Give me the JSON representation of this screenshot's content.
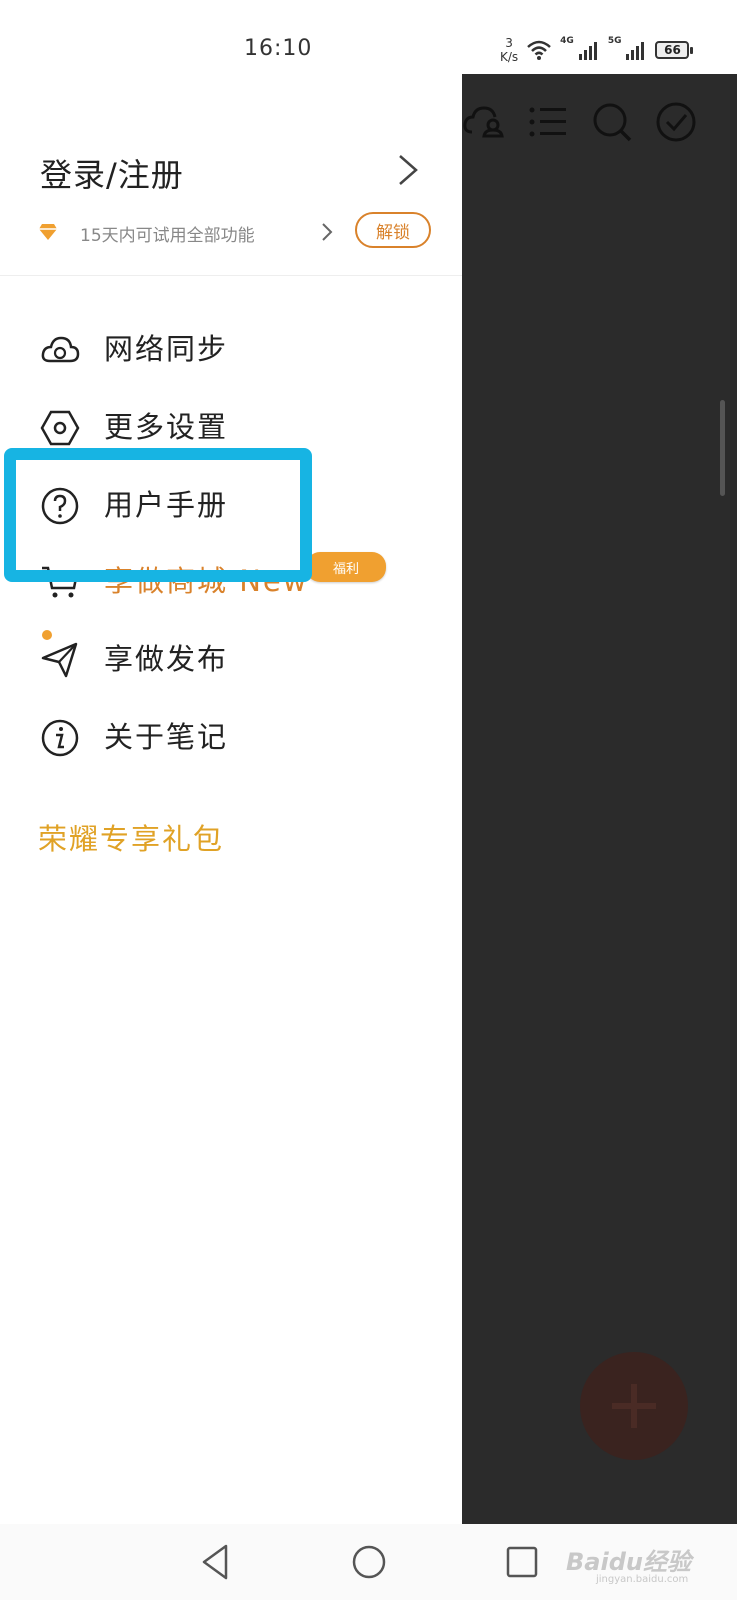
{
  "status_bar": {
    "time": "16:10",
    "net_speed_value": "3",
    "net_speed_unit": "K/s",
    "signal1_label": "4G",
    "signal2_label": "5G",
    "battery": "66"
  },
  "drawer": {
    "login_title": "登录/注册",
    "trial_text": "15天内可试用全部功能",
    "unlock_button": "解锁",
    "menu": [
      {
        "label": "网络同步",
        "icon": "cloud-sync-icon"
      },
      {
        "label": "更多设置",
        "icon": "hexagon-settings-icon"
      },
      {
        "label": "用户手册",
        "icon": "help-icon"
      },
      {
        "label": "享做商城 New",
        "icon": "cart-icon",
        "badge": "福利"
      },
      {
        "label": "享做发布",
        "icon": "paper-plane-icon"
      },
      {
        "label": "关于笔记",
        "icon": "info-icon"
      }
    ],
    "honor_link": "荣耀专享礼包"
  },
  "watermark": {
    "main": "Baidu经验",
    "sub": "jingyan.baidu.com"
  },
  "colors": {
    "accent_orange": "#d9822b",
    "gold": "#e0a226",
    "highlight_blue": "#17b4e3",
    "overlay": "#2b2b2b"
  }
}
